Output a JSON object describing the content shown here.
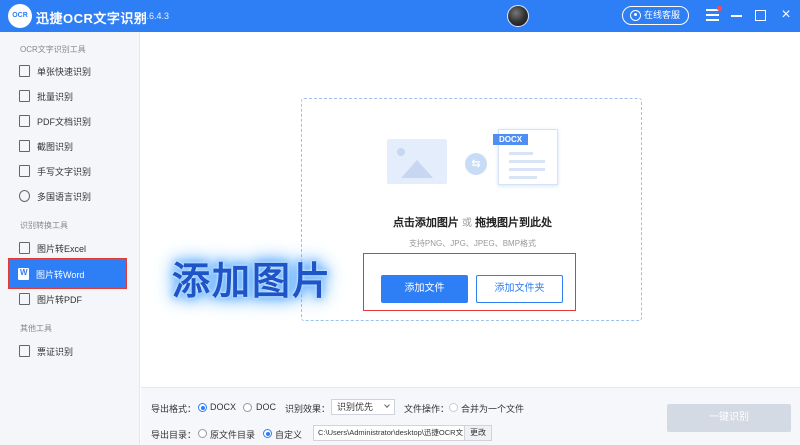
{
  "app": {
    "logo_text": "OCR",
    "title": "迅捷OCR文字识别",
    "version": "v8.6.4.3",
    "service_label": "在线客服",
    "close_label": "×"
  },
  "sidebar": {
    "section1_title": "OCR文字识别工具",
    "section2_title": "识别转换工具",
    "section3_title": "其他工具",
    "items1": [
      {
        "label": "单张快速识别"
      },
      {
        "label": "批量识别"
      },
      {
        "label": "PDF文档识别"
      },
      {
        "label": "截图识别"
      },
      {
        "label": "手写文字识别"
      },
      {
        "label": "多国语言识别"
      }
    ],
    "items2": [
      {
        "label": "图片转Excel"
      },
      {
        "label": "图片转Word"
      },
      {
        "label": "图片转PDF"
      }
    ],
    "items3": [
      {
        "label": "票证识别"
      }
    ]
  },
  "main": {
    "docx_tag": "DOCX",
    "swap_glyph": "⇆",
    "dropzone_title_a": "点击添加图片",
    "dropzone_title_or": "或",
    "dropzone_title_b": "拖拽图片到此处",
    "dropzone_subtitle": "支持PNG、JPG、JPEG、BMP格式",
    "add_file_label": "添加文件",
    "add_folder_label": "添加文件夹",
    "overlay_text": "添加图片"
  },
  "options": {
    "format_label": "导出格式：",
    "format_docx": "DOCX",
    "format_doc": "DOC",
    "effect_label": "识别效果：",
    "effect_value": "识别优先",
    "fileop_label": "文件操作：",
    "merge_label": "合并为一个文件",
    "dir_label": "导出目录：",
    "dir_original": "原文件目录",
    "dir_custom": "自定义",
    "path_value": "C:\\Users\\Administrator\\desktop\\迅捷OCR文",
    "change_label": "更改",
    "convert_label": "一键识别"
  }
}
